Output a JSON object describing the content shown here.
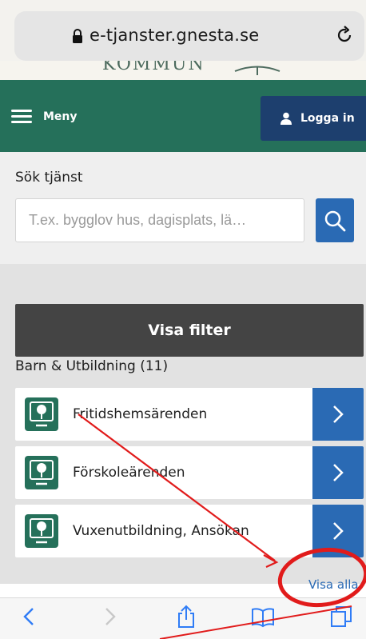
{
  "browser": {
    "url": "e-tjanster.gnesta.se",
    "logo_partial": "KOMMUN"
  },
  "nav": {
    "menu_label": "Meny",
    "login_label": "Logga in",
    "brand_color": "#25705a",
    "login_color": "#1d3f6e"
  },
  "search": {
    "label": "Sök tjänst",
    "placeholder": "T.ex. bygglov hus, dagisplats, lä…",
    "button_icon": "search-icon"
  },
  "filter": {
    "button_label": "Visa filter"
  },
  "category": {
    "title": "Barn & Utbildning (11)",
    "services": [
      {
        "label": "Fritidshemsärenden",
        "icon": "service-tree-icon"
      },
      {
        "label": "Förskoleärenden",
        "icon": "service-tree-icon"
      },
      {
        "label": "Vuxenutbildning, Ansökan",
        "icon": "service-tree-icon"
      }
    ],
    "show_all_label": "Visa alla"
  },
  "toolbar": {
    "icons": [
      "back-icon",
      "forward-icon",
      "share-icon",
      "bookmarks-icon",
      "tabs-icon"
    ]
  },
  "accent_color": "#2a6ab4",
  "annotation_color": "#e11b1b"
}
